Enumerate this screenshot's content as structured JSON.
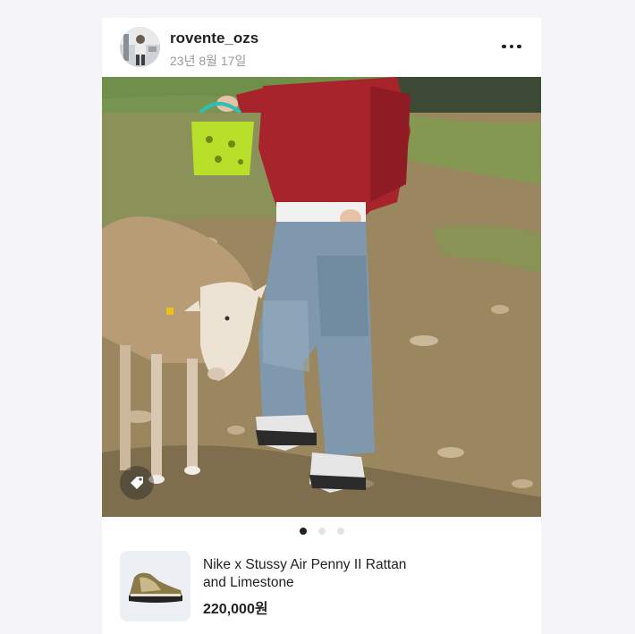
{
  "post": {
    "username": "rovente_ozs",
    "date": "23년 8월 17일",
    "avatar_icon": "user-avatar",
    "more_icon": "more-horizontal-icon",
    "tag_icon": "price-tag-icon",
    "carousel": {
      "count": 3,
      "active_index": 0
    }
  },
  "product": {
    "name_line1": "Nike x Stussy Air Penny II Rattan",
    "name_line2": "and Limestone",
    "price": "220,000원",
    "thumb_icon": "sneaker-icon"
  },
  "colors": {
    "accent_dark": "#222222",
    "muted_text": "#9a9a9a",
    "dot_inactive": "#e3e3e3",
    "jacket": "#b8282f",
    "basket": "#b8df2a"
  }
}
